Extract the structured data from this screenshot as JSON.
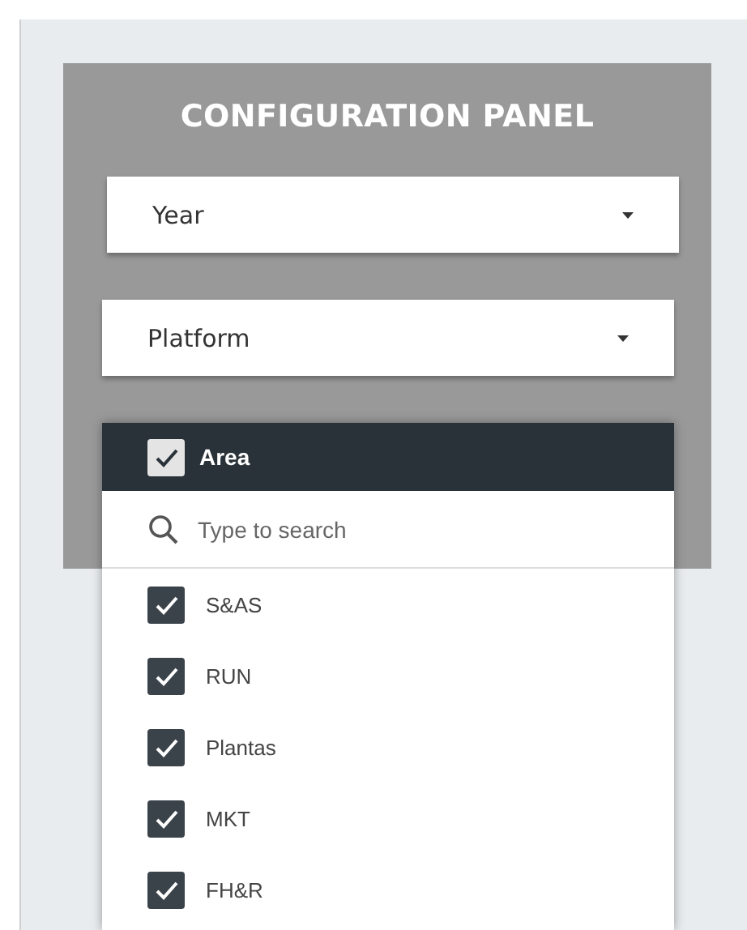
{
  "panel": {
    "title": "CONFIGURATION PANEL",
    "selects": [
      {
        "label": "Year"
      },
      {
        "label": "Platform"
      }
    ]
  },
  "dropdown": {
    "header": {
      "label": "Area",
      "checked": true
    },
    "search": {
      "placeholder": "Type to search"
    },
    "options": [
      {
        "label": "S&AS",
        "checked": true
      },
      {
        "label": "RUN",
        "checked": true
      },
      {
        "label": "Plantas",
        "checked": true
      },
      {
        "label": "MKT",
        "checked": true
      },
      {
        "label": "FH&R",
        "checked": true
      }
    ]
  }
}
